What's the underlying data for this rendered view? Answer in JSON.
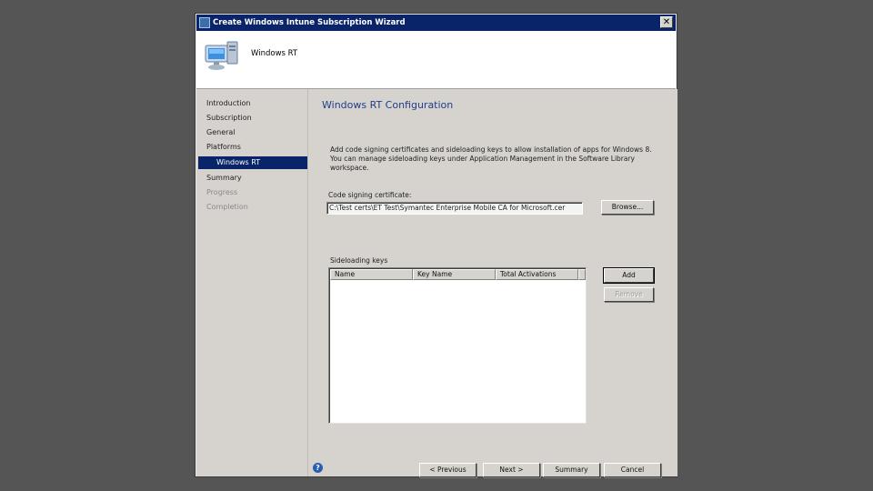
{
  "window": {
    "title": "Create Windows Intune Subscription Wizard",
    "close_glyph": "✕"
  },
  "header": {
    "title": "Windows RT",
    "icon": "computer-icon"
  },
  "nav": {
    "items": [
      {
        "label": "Introduction"
      },
      {
        "label": "Subscription"
      },
      {
        "label": "General"
      },
      {
        "label": "Platforms"
      },
      {
        "label": "Windows RT"
      },
      {
        "label": "Summary"
      },
      {
        "label": "Progress"
      },
      {
        "label": "Completion"
      }
    ]
  },
  "page": {
    "title": "Windows RT Configuration",
    "description": "Add code signing certificates and sideloading keys to allow installation of apps for Windows 8. You can manage sideloading keys under Application Management in the Software Library workspace.",
    "cert_label": "Code signing certificate:",
    "cert_value": "C:\\Test certs\\ET Test\\Symantec Enterprise Mobile CA for Microsoft.cer",
    "browse_label": "Browse...",
    "sideload_label": "Sideloading keys",
    "columns": [
      "Name",
      "Key Name",
      "Total Activations"
    ],
    "add_label": "Add",
    "remove_label": "Remove"
  },
  "footer": {
    "help_glyph": "?",
    "previous_label": "< Previous",
    "next_label": "Next >",
    "summary_label": "Summary",
    "cancel_label": "Cancel"
  },
  "colors": {
    "titlebar": "#0a246a",
    "selection": "#0a246a",
    "page_title": "#1f3e8c",
    "dialog_face": "#d6d3ce"
  }
}
